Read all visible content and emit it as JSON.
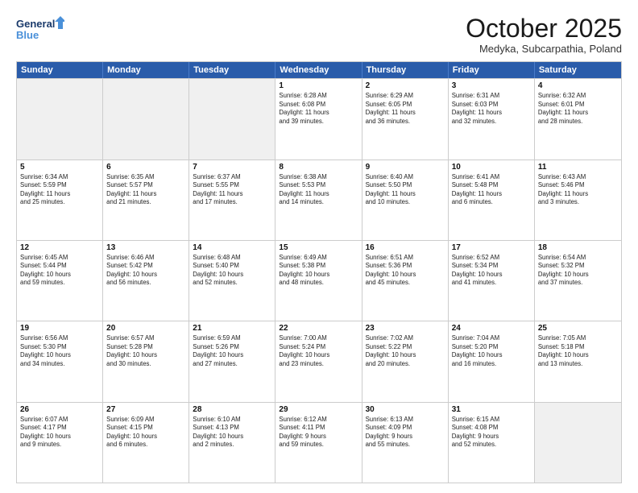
{
  "header": {
    "logo_line1": "General",
    "logo_line2": "Blue",
    "month_title": "October 2025",
    "location": "Medyka, Subcarpathia, Poland"
  },
  "days_of_week": [
    "Sunday",
    "Monday",
    "Tuesday",
    "Wednesday",
    "Thursday",
    "Friday",
    "Saturday"
  ],
  "rows": [
    [
      {
        "day": "",
        "info": ""
      },
      {
        "day": "",
        "info": ""
      },
      {
        "day": "",
        "info": ""
      },
      {
        "day": "1",
        "info": "Sunrise: 6:28 AM\nSunset: 6:08 PM\nDaylight: 11 hours\nand 39 minutes."
      },
      {
        "day": "2",
        "info": "Sunrise: 6:29 AM\nSunset: 6:05 PM\nDaylight: 11 hours\nand 36 minutes."
      },
      {
        "day": "3",
        "info": "Sunrise: 6:31 AM\nSunset: 6:03 PM\nDaylight: 11 hours\nand 32 minutes."
      },
      {
        "day": "4",
        "info": "Sunrise: 6:32 AM\nSunset: 6:01 PM\nDaylight: 11 hours\nand 28 minutes."
      }
    ],
    [
      {
        "day": "5",
        "info": "Sunrise: 6:34 AM\nSunset: 5:59 PM\nDaylight: 11 hours\nand 25 minutes."
      },
      {
        "day": "6",
        "info": "Sunrise: 6:35 AM\nSunset: 5:57 PM\nDaylight: 11 hours\nand 21 minutes."
      },
      {
        "day": "7",
        "info": "Sunrise: 6:37 AM\nSunset: 5:55 PM\nDaylight: 11 hours\nand 17 minutes."
      },
      {
        "day": "8",
        "info": "Sunrise: 6:38 AM\nSunset: 5:53 PM\nDaylight: 11 hours\nand 14 minutes."
      },
      {
        "day": "9",
        "info": "Sunrise: 6:40 AM\nSunset: 5:50 PM\nDaylight: 11 hours\nand 10 minutes."
      },
      {
        "day": "10",
        "info": "Sunrise: 6:41 AM\nSunset: 5:48 PM\nDaylight: 11 hours\nand 6 minutes."
      },
      {
        "day": "11",
        "info": "Sunrise: 6:43 AM\nSunset: 5:46 PM\nDaylight: 11 hours\nand 3 minutes."
      }
    ],
    [
      {
        "day": "12",
        "info": "Sunrise: 6:45 AM\nSunset: 5:44 PM\nDaylight: 10 hours\nand 59 minutes."
      },
      {
        "day": "13",
        "info": "Sunrise: 6:46 AM\nSunset: 5:42 PM\nDaylight: 10 hours\nand 56 minutes."
      },
      {
        "day": "14",
        "info": "Sunrise: 6:48 AM\nSunset: 5:40 PM\nDaylight: 10 hours\nand 52 minutes."
      },
      {
        "day": "15",
        "info": "Sunrise: 6:49 AM\nSunset: 5:38 PM\nDaylight: 10 hours\nand 48 minutes."
      },
      {
        "day": "16",
        "info": "Sunrise: 6:51 AM\nSunset: 5:36 PM\nDaylight: 10 hours\nand 45 minutes."
      },
      {
        "day": "17",
        "info": "Sunrise: 6:52 AM\nSunset: 5:34 PM\nDaylight: 10 hours\nand 41 minutes."
      },
      {
        "day": "18",
        "info": "Sunrise: 6:54 AM\nSunset: 5:32 PM\nDaylight: 10 hours\nand 37 minutes."
      }
    ],
    [
      {
        "day": "19",
        "info": "Sunrise: 6:56 AM\nSunset: 5:30 PM\nDaylight: 10 hours\nand 34 minutes."
      },
      {
        "day": "20",
        "info": "Sunrise: 6:57 AM\nSunset: 5:28 PM\nDaylight: 10 hours\nand 30 minutes."
      },
      {
        "day": "21",
        "info": "Sunrise: 6:59 AM\nSunset: 5:26 PM\nDaylight: 10 hours\nand 27 minutes."
      },
      {
        "day": "22",
        "info": "Sunrise: 7:00 AM\nSunset: 5:24 PM\nDaylight: 10 hours\nand 23 minutes."
      },
      {
        "day": "23",
        "info": "Sunrise: 7:02 AM\nSunset: 5:22 PM\nDaylight: 10 hours\nand 20 minutes."
      },
      {
        "day": "24",
        "info": "Sunrise: 7:04 AM\nSunset: 5:20 PM\nDaylight: 10 hours\nand 16 minutes."
      },
      {
        "day": "25",
        "info": "Sunrise: 7:05 AM\nSunset: 5:18 PM\nDaylight: 10 hours\nand 13 minutes."
      }
    ],
    [
      {
        "day": "26",
        "info": "Sunrise: 6:07 AM\nSunset: 4:17 PM\nDaylight: 10 hours\nand 9 minutes."
      },
      {
        "day": "27",
        "info": "Sunrise: 6:09 AM\nSunset: 4:15 PM\nDaylight: 10 hours\nand 6 minutes."
      },
      {
        "day": "28",
        "info": "Sunrise: 6:10 AM\nSunset: 4:13 PM\nDaylight: 10 hours\nand 2 minutes."
      },
      {
        "day": "29",
        "info": "Sunrise: 6:12 AM\nSunset: 4:11 PM\nDaylight: 9 hours\nand 59 minutes."
      },
      {
        "day": "30",
        "info": "Sunrise: 6:13 AM\nSunset: 4:09 PM\nDaylight: 9 hours\nand 55 minutes."
      },
      {
        "day": "31",
        "info": "Sunrise: 6:15 AM\nSunset: 4:08 PM\nDaylight: 9 hours\nand 52 minutes."
      },
      {
        "day": "",
        "info": ""
      }
    ]
  ]
}
